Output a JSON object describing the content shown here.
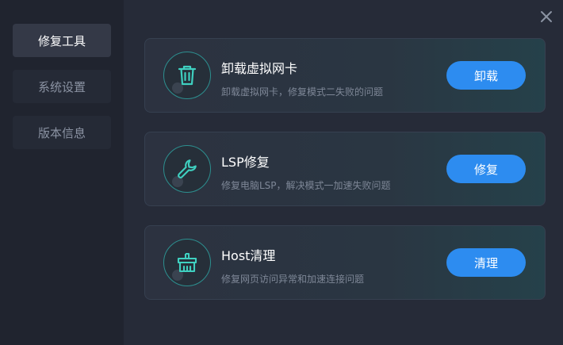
{
  "sidebar": {
    "items": [
      {
        "label": "修复工具",
        "active": true
      },
      {
        "label": "系统设置",
        "active": false
      },
      {
        "label": "版本信息",
        "active": false
      }
    ]
  },
  "cards": [
    {
      "icon": "trash-icon",
      "title": "卸载虚拟网卡",
      "desc": "卸载虚拟网卡，修复模式二失败的问题",
      "button": "卸载"
    },
    {
      "icon": "wrench-icon",
      "title": "LSP修复",
      "desc": "修复电脑LSP，解决模式一加速失败问题",
      "button": "修复"
    },
    {
      "icon": "broom-icon",
      "title": "Host清理",
      "desc": "修复网页访问异常和加速连接问题",
      "button": "清理"
    }
  ],
  "colors": {
    "accent": "#2d8cf0",
    "icon_teal": "#3fd0c0",
    "background": "#262b38",
    "sidebar": "#20242f"
  }
}
